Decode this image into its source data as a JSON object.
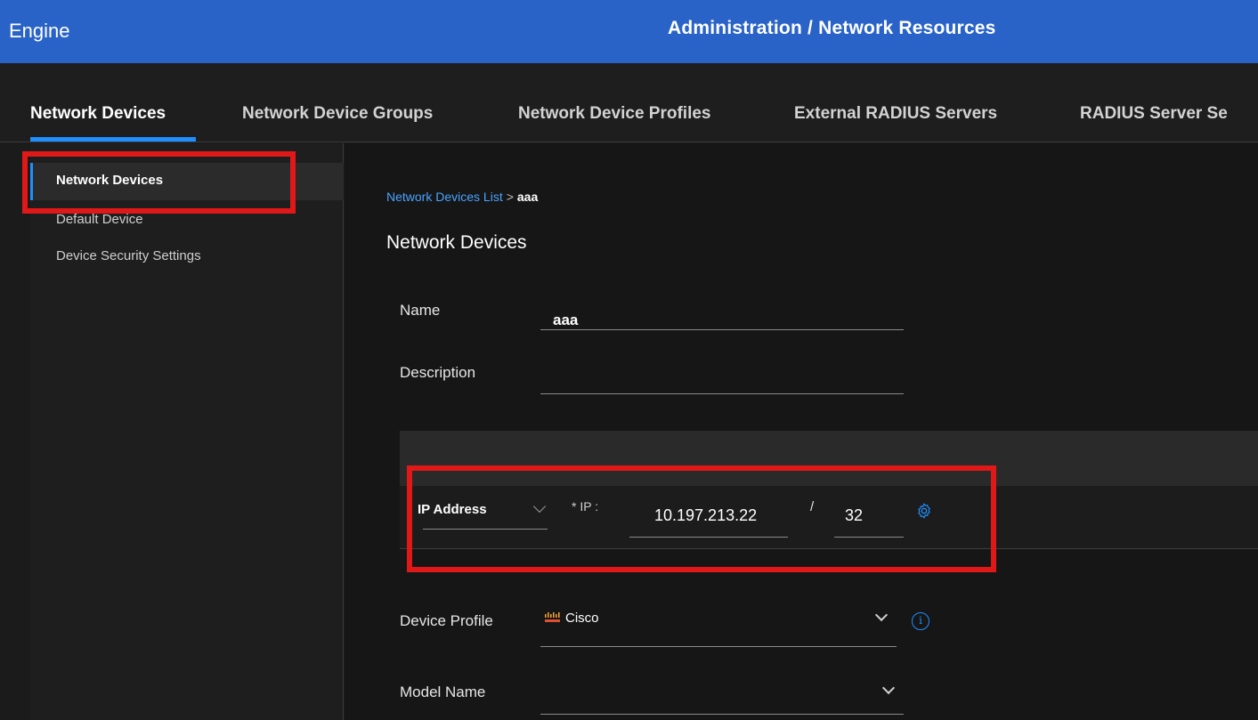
{
  "header": {
    "app_title": "Engine",
    "breadcrumb": "Administration / Network Resources"
  },
  "tabs": [
    {
      "label": "Network Devices",
      "active": true
    },
    {
      "label": "Network Device Groups",
      "active": false
    },
    {
      "label": "Network Device Profiles",
      "active": false
    },
    {
      "label": "External RADIUS Servers",
      "active": false
    },
    {
      "label": "RADIUS Server Se",
      "active": false
    }
  ],
  "sidebar": {
    "items": [
      {
        "label": "Network Devices",
        "active": true
      },
      {
        "label": "Default Device",
        "active": false
      },
      {
        "label": "Device Security Settings",
        "active": false
      }
    ]
  },
  "content": {
    "breadcrumb": {
      "link": "Network Devices List",
      "separator": ">",
      "current": "aaa"
    },
    "title": "Network Devices",
    "form": {
      "name_label": "Name",
      "name_value": "aaa",
      "description_label": "Description",
      "description_value": "",
      "ip_type": "IP Address",
      "ip_label": "* IP :",
      "ip_value": "10.197.213.22",
      "mask_sep": "/",
      "mask_value": "32",
      "device_profile_label": "Device Profile",
      "device_profile_value": "Cisco",
      "model_name_label": "Model Name",
      "model_name_value": ""
    }
  },
  "icons": {
    "settings": "gear-icon",
    "info": "info-icon",
    "dropdown": "chevron-down-icon",
    "vendor": "cisco-logo-icon"
  },
  "colors": {
    "header_bg": "#2a63c8",
    "accent": "#1f8fff",
    "highlight": "#e01818",
    "background": "#161616"
  }
}
